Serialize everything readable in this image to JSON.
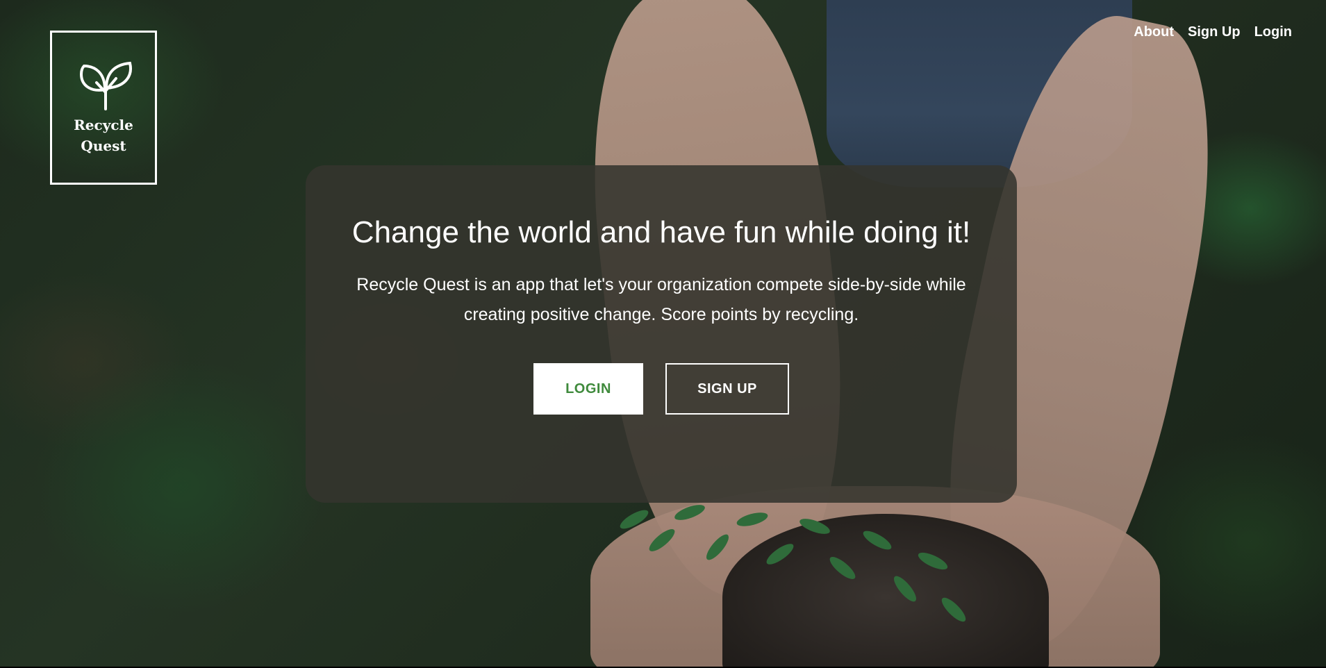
{
  "brand": {
    "line1": "Recycle",
    "line2": "Quest",
    "icon": "leaves-icon"
  },
  "nav": {
    "about": "About",
    "signup": "Sign Up",
    "login": "Login"
  },
  "hero": {
    "headline": "Change the world and have fun while doing it!",
    "subtext": "Recycle Quest is an app that let's your organization compete side-by-side while creating positive change. Score points by recycling.",
    "login_button": "LOGIN",
    "signup_button": "SIGN UP"
  },
  "colors": {
    "accent_green": "#3f8a3c",
    "card_overlay": "#34342e",
    "text": "#ffffff"
  }
}
